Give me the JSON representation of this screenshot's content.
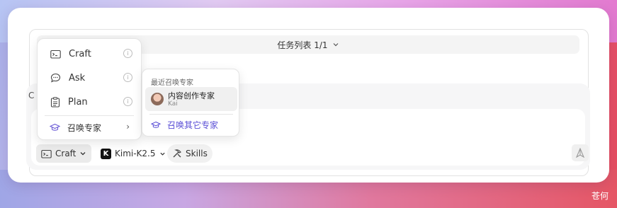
{
  "task_bar": {
    "label": "任务列表 1/1"
  },
  "input": {
    "edge_glyph": "C"
  },
  "mode_menu": {
    "items": [
      {
        "label": "Craft",
        "icon": "terminal-folder-icon"
      },
      {
        "label": "Ask",
        "icon": "chat-bubble-icon"
      },
      {
        "label": "Plan",
        "icon": "clipboard-list-icon"
      }
    ],
    "info_glyph": "i",
    "summon": {
      "label": "召唤专家",
      "icon": "graduation-cap-icon",
      "chevron": "›"
    }
  },
  "expert_menu": {
    "title": "最近召唤专家",
    "recent": [
      {
        "name": "内容创作专家",
        "sub": "Kai"
      }
    ],
    "more_label": "召唤其它专家",
    "accent": "#5b4fd6"
  },
  "toolbar": {
    "mode_label": "Craft",
    "model_label": "Kimi-K2.5",
    "model_logo": "K",
    "skills_label": "Skills"
  },
  "watermark": "苍何"
}
